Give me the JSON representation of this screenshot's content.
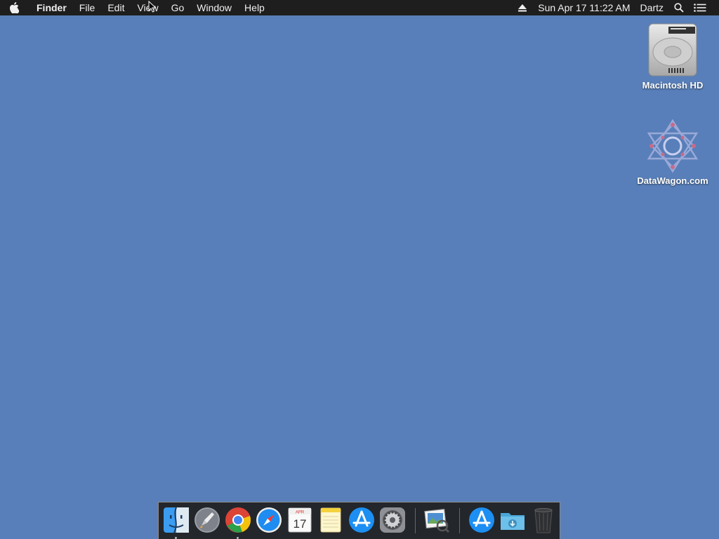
{
  "menubar": {
    "apple_icon": "apple-logo-icon",
    "app_name": "Finder",
    "menus": [
      "File",
      "Edit",
      "View",
      "Go",
      "Window",
      "Help"
    ],
    "eject_icon": "eject-icon",
    "clock": "Sun Apr 17  11:22 AM",
    "user": "Dartz",
    "search_icon": "spotlight-search-icon",
    "notifications_icon": "notification-center-icon"
  },
  "desktop": {
    "background_color": "#587fb9",
    "icons": [
      {
        "label": "Macintosh HD",
        "icon": "hard-drive-icon"
      },
      {
        "label": "DataWagon.com",
        "icon": "network-share-icon"
      }
    ]
  },
  "dock": {
    "apps": [
      {
        "name": "Finder",
        "icon": "finder-icon",
        "running": true
      },
      {
        "name": "Launchpad",
        "icon": "launchpad-icon",
        "running": false
      },
      {
        "name": "Google Chrome",
        "icon": "chrome-icon",
        "running": true
      },
      {
        "name": "Safari",
        "icon": "safari-icon",
        "running": false
      },
      {
        "name": "Calendar",
        "icon": "calendar-icon",
        "running": false,
        "month": "APR",
        "day": "17"
      },
      {
        "name": "Notes",
        "icon": "notes-icon",
        "running": false
      },
      {
        "name": "App Store",
        "icon": "app-store-icon",
        "running": false
      },
      {
        "name": "System Preferences",
        "icon": "system-preferences-icon",
        "running": false
      },
      {
        "name": "Preview",
        "icon": "preview-icon",
        "running": false
      },
      {
        "name": "Applications",
        "icon": "applications-folder-icon",
        "running": false
      },
      {
        "name": "Downloads",
        "icon": "downloads-folder-icon",
        "running": false
      },
      {
        "name": "Trash",
        "icon": "trash-icon",
        "running": false
      }
    ]
  }
}
